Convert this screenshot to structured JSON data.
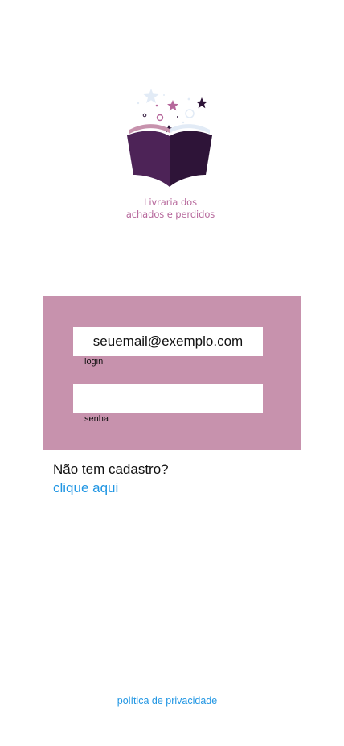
{
  "logo": {
    "line1": "Livraria dos",
    "line2": "achados e perdidos",
    "icon": "open-book-with-stars-icon"
  },
  "login_form": {
    "email_placeholder": "seuemail@exemplo.com",
    "email_label": "login",
    "password_value": "",
    "password_label": "senha"
  },
  "signup": {
    "question": "Não tem cadastro?",
    "link": "clique aqui"
  },
  "footer": {
    "privacy_link": "política de privacidade"
  },
  "colors": {
    "panel": "#c792ad",
    "brand_pink": "#b6679b",
    "book_dark": "#2e1438",
    "book_mid": "#4d2357",
    "link": "#2196e3"
  }
}
